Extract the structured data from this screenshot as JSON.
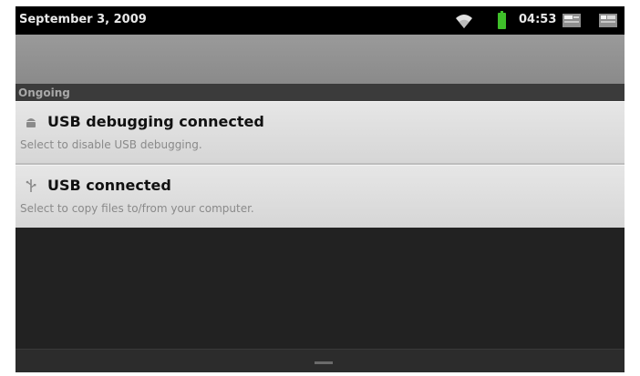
{
  "status_bar": {
    "date": "September 3, 2009",
    "time": "04:53",
    "icons": [
      "wifi-icon",
      "battery-icon",
      "notification-tray-icon",
      "notification-tray-icon"
    ],
    "battery_color": "#3fbf2a"
  },
  "notifications": {
    "section_title": "Ongoing",
    "items": [
      {
        "icon": "android-debug-icon",
        "title": "USB debugging connected",
        "text": "Select to disable USB debugging."
      },
      {
        "icon": "usb-icon",
        "title": "USB connected",
        "text": "Select to copy files to/from your computer."
      }
    ]
  }
}
